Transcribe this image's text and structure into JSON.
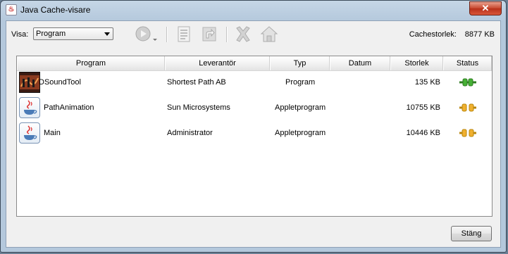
{
  "window": {
    "title": "Java Cache-visare",
    "close_glyph": "✕"
  },
  "toolbar": {
    "visa_label": "Visa:",
    "visa_value": "Program",
    "cache_label": "Cachestorlek:",
    "cache_value": "8877 KB",
    "icons": [
      "run-icon",
      "info-icon",
      "create-shortcut-icon",
      "delete-icon",
      "home-icon"
    ]
  },
  "table": {
    "headers": {
      "program": "Program",
      "vendor": "Leverantör",
      "type": "Typ",
      "date": "Datum",
      "size": "Storlek",
      "status": "Status"
    },
    "rows": [
      {
        "name": "DSoundTool",
        "vendor": "Shortest Path AB",
        "type": "Program",
        "date": "",
        "size": "135 KB",
        "status": "green-connected"
      },
      {
        "name": "PathAnimation",
        "vendor": "Sun Microsystems",
        "type": "Appletprogram",
        "date": "",
        "size": "10755 KB",
        "status": "orange-disconnected"
      },
      {
        "name": "Main",
        "vendor": "Administrator",
        "type": "Appletprogram",
        "date": "",
        "size": "10446 KB",
        "status": "orange-disconnected"
      }
    ]
  },
  "buttons": {
    "close_label": "Stäng"
  },
  "colors": {
    "status_green": "#3a9a2a",
    "status_orange": "#e0a020",
    "close_red": "#c7462c"
  }
}
